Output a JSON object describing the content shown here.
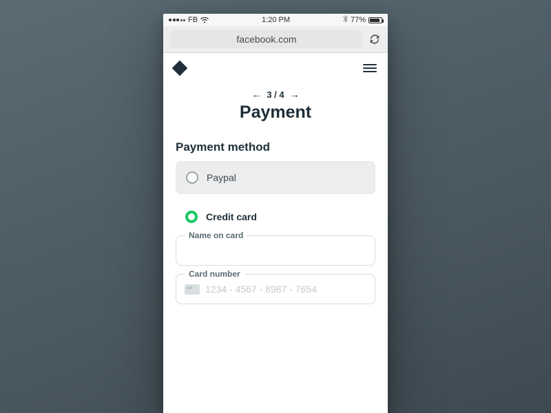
{
  "statusbar": {
    "carrier": "FB",
    "time": "1:20 PM",
    "battery_pct": "77%"
  },
  "browser": {
    "url": "facebook.com"
  },
  "stepper": {
    "label": "3 / 4"
  },
  "title": "Payment",
  "section_title": "Payment method",
  "methods": {
    "paypal": {
      "label": "Paypal"
    },
    "credit": {
      "label": "Credit card"
    }
  },
  "fields": {
    "name": {
      "label": "Name on card",
      "value": ""
    },
    "card": {
      "label": "Card number",
      "placeholder": "1234 - 4567 - 8987 - 7654",
      "value": ""
    }
  },
  "colors": {
    "accent": "#18c964",
    "ink": "#1e2e38"
  }
}
